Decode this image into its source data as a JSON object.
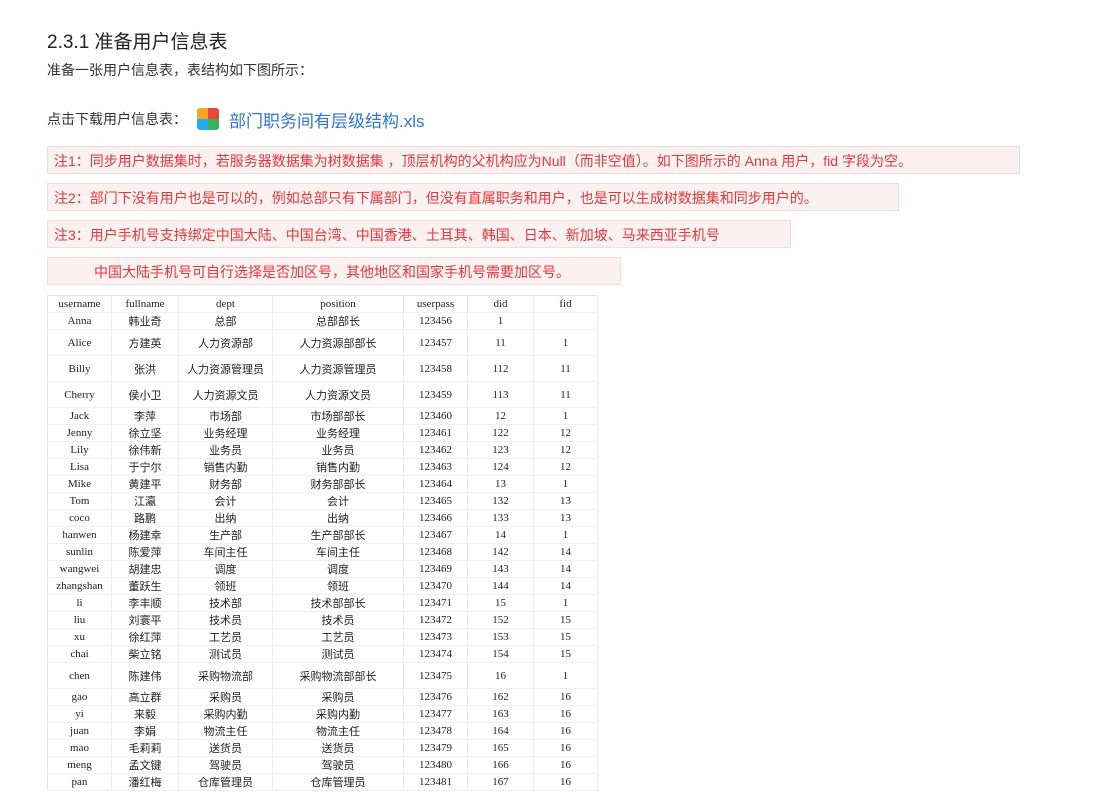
{
  "heading": "2.3.1 准备用户信息表",
  "intro": "准备一张用户信息表，表结构如下图所示：",
  "download": {
    "label": "点击下载用户信息表：",
    "icon": "xls-file-icon",
    "file_name": "部门职务间有层级结构.xls"
  },
  "notes": [
    "注1：同步用户数据集时，若服务器数据集为树数据集 ，顶层机构的父机构应为Null（而非空值）。如下图所示的 Anna 用户，fid 字段为空。",
    "注2：部门下没有用户也是可以的，例如总部只有下属部门，但没有直属职务和用户，也是可以生成树数据集和同步用户的。",
    "注3：用户手机号支持绑定中国大陆、中国台湾、中国香港、土耳其、韩国、日本、新加坡、马来西亚手机号",
    "中国大陆手机号可自行选择是否加区号，其他地区和国家手机号需要加区号。"
  ],
  "colors": {
    "note_text": "#e5383b",
    "note_bg": "#fbf1f1",
    "link": "#2e76d6"
  },
  "table": {
    "columns": [
      "username",
      "fullname",
      "dept",
      "position",
      "userpass",
      "did",
      "fid"
    ],
    "rows": [
      [
        "Anna",
        "韩业奇",
        "总部",
        "总部部长",
        "123456",
        "1",
        ""
      ],
      [
        "Alice",
        "方建英",
        "人力资源部",
        "人力资源部部长",
        "123457",
        "11",
        "1"
      ],
      [
        "Billy",
        "张洪",
        "人力资源管理员",
        "人力资源管理员",
        "123458",
        "112",
        "11"
      ],
      [
        "Cherry",
        "侯小卫",
        "人力资源文员",
        "人力资源文员",
        "123459",
        "113",
        "11"
      ],
      [
        "Jack",
        "李萍",
        "市场部",
        "市场部部长",
        "123460",
        "12",
        "1"
      ],
      [
        "Jenny",
        "徐立坚",
        "业务经理",
        "业务经理",
        "123461",
        "122",
        "12"
      ],
      [
        "Lily",
        "徐伟新",
        "业务员",
        "业务员",
        "123462",
        "123",
        "12"
      ],
      [
        "Lisa",
        "于宁尔",
        "销售内勤",
        "销售内勤",
        "123463",
        "124",
        "12"
      ],
      [
        "Mike",
        "黄建平",
        "财务部",
        "财务部部长",
        "123464",
        "13",
        "1"
      ],
      [
        "Tom",
        "江瀛",
        "会计",
        "会计",
        "123465",
        "132",
        "13"
      ],
      [
        "coco",
        "路鹏",
        "出纳",
        "出纳",
        "123466",
        "133",
        "13"
      ],
      [
        "hanwen",
        "杨建幸",
        "生产部",
        "生产部部长",
        "123467",
        "14",
        "1"
      ],
      [
        "sunlin",
        "陈爱萍",
        "车间主任",
        "车间主任",
        "123468",
        "142",
        "14"
      ],
      [
        "wangwei",
        "胡建忠",
        "调度",
        "调度",
        "123469",
        "143",
        "14"
      ],
      [
        "zhangshan",
        "董跃生",
        "领班",
        "领班",
        "123470",
        "144",
        "14"
      ],
      [
        "li",
        "李丰顺",
        "技术部",
        "技术部部长",
        "123471",
        "15",
        "1"
      ],
      [
        "liu",
        "刘寰平",
        "技术员",
        "技术员",
        "123472",
        "152",
        "15"
      ],
      [
        "xu",
        "徐红萍",
        "工艺员",
        "工艺员",
        "123473",
        "153",
        "15"
      ],
      [
        "chai",
        "柴立铭",
        "测试员",
        "测试员",
        "123474",
        "154",
        "15"
      ],
      [
        "chen",
        "陈建伟",
        "采购物流部",
        "采购物流部部长",
        "123475",
        "16",
        "1"
      ],
      [
        "gao",
        "高立群",
        "采购员",
        "采购员",
        "123476",
        "162",
        "16"
      ],
      [
        "yi",
        "来毅",
        "采购内勤",
        "采购内勤",
        "123477",
        "163",
        "16"
      ],
      [
        "juan",
        "李娟",
        "物流主任",
        "物流主任",
        "123478",
        "164",
        "16"
      ],
      [
        "mao",
        "毛莉莉",
        "送货员",
        "送货员",
        "123479",
        "165",
        "16"
      ],
      [
        "meng",
        "孟文键",
        "驾驶员",
        "驾驶员",
        "123480",
        "166",
        "16"
      ],
      [
        "pan",
        "潘红梅",
        "仓库管理员",
        "仓库管理员",
        "123481",
        "167",
        "16"
      ]
    ]
  }
}
